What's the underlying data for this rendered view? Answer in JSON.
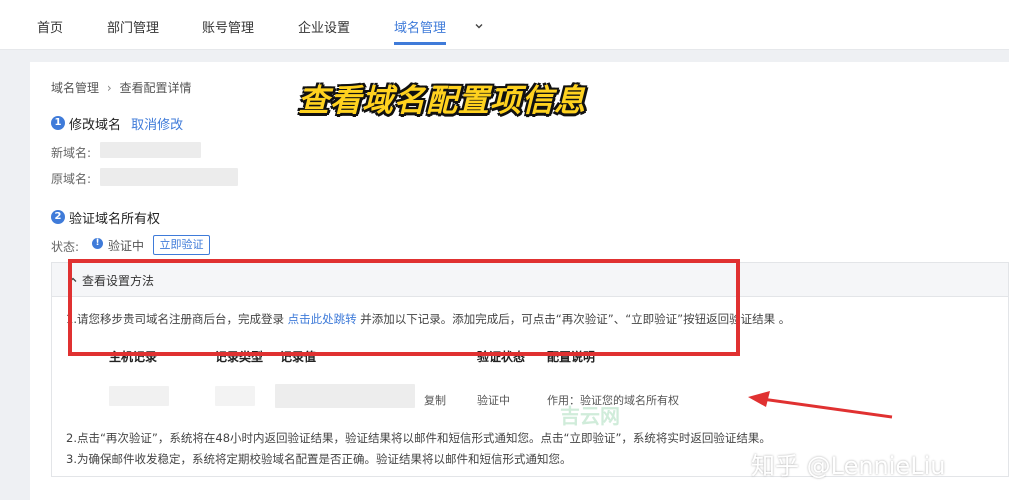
{
  "nav": {
    "items": [
      {
        "label": "首页"
      },
      {
        "label": "部门管理"
      },
      {
        "label": "账号管理"
      },
      {
        "label": "企业设置"
      },
      {
        "label": "域名管理"
      }
    ],
    "more_icon": "chevron-down-icon"
  },
  "breadcrumb": {
    "root": "域名管理",
    "sep": "›",
    "current": "查看配置详情"
  },
  "banner": "查看域名配置项信息",
  "step1": {
    "num": "1",
    "title": "修改域名",
    "cancel_link": "取消修改",
    "new_label": "新域名:",
    "old_label": "原域名:"
  },
  "step2": {
    "num": "2",
    "title": "验证域名所有权",
    "status_label": "状态:",
    "status_icon": "info-icon",
    "status_value": "验证中",
    "verify_button": "立即验证"
  },
  "method": {
    "title": "查看设置方法",
    "line1_a": "1.请您移步贵司域名注册商后台，完成登录 ",
    "line1_link": "点击此处跳转",
    "line1_b": " 并添加以下记录。添加完成后，可点击“再次验证”、“立即验证”按钮返回验证结果 。",
    "line2": "2.点击“再次验证”，系统将在48小时内返回验证结果，验证结果将以邮件和短信形式通知您。点击“立即验证”，系统将实时返回验证结果。",
    "line3": "3.为确保邮件收发稳定，系统将定期校验域名配置是否正确。验证结果将以邮件和短信形式通知您。"
  },
  "table": {
    "headers": [
      "主机记录",
      "记录类型",
      "记录值",
      "验证状态",
      "配置说明"
    ],
    "row": {
      "copy": "复制",
      "status": "验证中",
      "desc": "作用：验证您的域名所有权"
    }
  },
  "watermark": "知乎 @LennieLiu",
  "faint_watermark": "吉云网",
  "colors": {
    "accent": "#3f7bd9",
    "highlight": "#e03131",
    "banner": "#ffd21f"
  }
}
